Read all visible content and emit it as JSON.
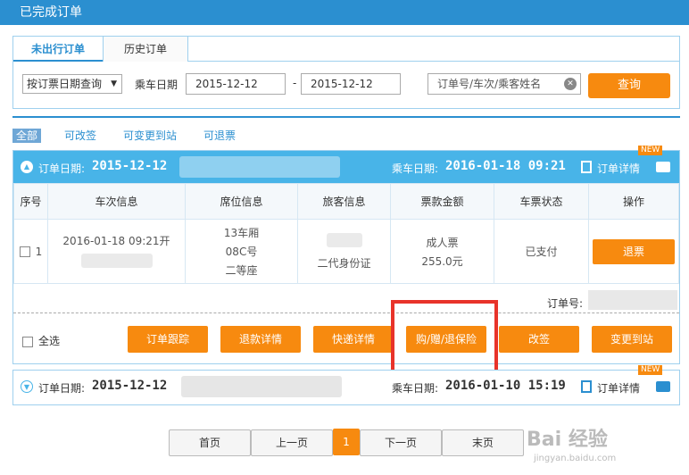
{
  "window_title": "已完成订单",
  "tabs": [
    {
      "label": "未出行订单"
    },
    {
      "label": "历史订单"
    }
  ],
  "search": {
    "query_type": "按订票日期查询",
    "date_label": "乘车日期",
    "date_from": "2015-12-12",
    "date_to": "2015-12-12",
    "keyword_placeholder": "订单号/车次/乘客姓名",
    "query_button": "查询"
  },
  "filters": [
    "全部",
    "可改签",
    "可变更到站",
    "可退票"
  ],
  "orders": [
    {
      "order_date_label": "订单日期:",
      "order_date": "2015-12-12",
      "ride_date_label": "乘车日期:",
      "ride_date": "2016-01-18 09:21",
      "detail_label": "订单详情",
      "new_badge": "NEW",
      "columns": [
        "序号",
        "车次信息",
        "席位信息",
        "旅客信息",
        "票款金额",
        "车票状态",
        "操作"
      ],
      "tickets": [
        {
          "index": "1",
          "train": "2016-01-18 09:21开",
          "car": "13车厢",
          "seat": "08C号",
          "seat_class": "二等座",
          "id_type": "二代身份证",
          "ticket_type": "成人票",
          "price": "255.0元",
          "status": "已支付",
          "action": "退票"
        }
      ],
      "order_no_label": "订单号:",
      "select_all": "全选",
      "actions": [
        "订单跟踪",
        "退款详情",
        "快递详情",
        "购/赠/退保险",
        "改签",
        "变更到站"
      ]
    },
    {
      "order_date_label": "订单日期:",
      "order_date": "2015-12-12",
      "ride_date_label": "乘车日期:",
      "ride_date": "2016-01-10 15:19",
      "detail_label": "订单详情",
      "new_badge": "NEW"
    }
  ],
  "pager": {
    "first": "首页",
    "prev": "上一页",
    "current": "1",
    "next": "下一页",
    "last": "末页"
  },
  "watermark": {
    "brand": "Bai 经验",
    "url": "jingyan.baidu.com"
  },
  "colors": {
    "accent": "#2b8fd0",
    "header_bg": "#48b4e8",
    "button_orange": "#f78a0f",
    "highlight_red": "#e8332a"
  }
}
